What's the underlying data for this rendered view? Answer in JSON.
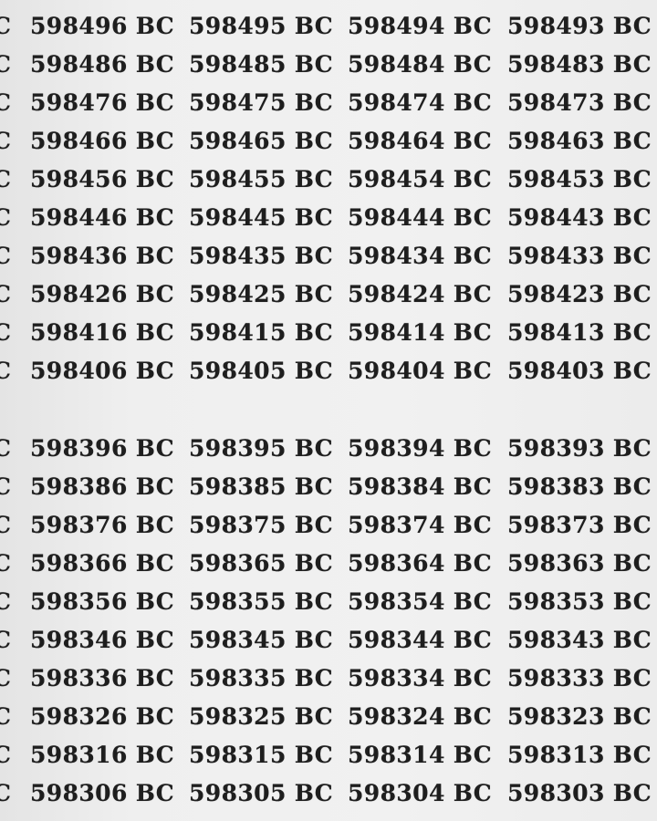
{
  "top_block": [
    {
      "partial": "C",
      "cells": [
        {
          "num": "598496",
          "suffix": "BC"
        },
        {
          "num": "598495",
          "suffix": "BC"
        },
        {
          "num": "598494",
          "suffix": "BC"
        },
        {
          "num": "598493",
          "suffix": "BC"
        }
      ]
    },
    {
      "partial": "C",
      "cells": [
        {
          "num": "598486",
          "suffix": "BC"
        },
        {
          "num": "598485",
          "suffix": "BC"
        },
        {
          "num": "598484",
          "suffix": "BC"
        },
        {
          "num": "598483",
          "suffix": "BC"
        }
      ]
    },
    {
      "partial": "C",
      "cells": [
        {
          "num": "598476",
          "suffix": "BC"
        },
        {
          "num": "598475",
          "suffix": "BC"
        },
        {
          "num": "598474",
          "suffix": "BC"
        },
        {
          "num": "598473",
          "suffix": "BC"
        }
      ]
    },
    {
      "partial": "C",
      "cells": [
        {
          "num": "598466",
          "suffix": "BC"
        },
        {
          "num": "598465",
          "suffix": "BC"
        },
        {
          "num": "598464",
          "suffix": "BC"
        },
        {
          "num": "598463",
          "suffix": "BC"
        }
      ]
    },
    {
      "partial": "C",
      "cells": [
        {
          "num": "598456",
          "suffix": "BC"
        },
        {
          "num": "598455",
          "suffix": "BC"
        },
        {
          "num": "598454",
          "suffix": "BC"
        },
        {
          "num": "598453",
          "suffix": "BC"
        }
      ]
    },
    {
      "partial": "C",
      "cells": [
        {
          "num": "598446",
          "suffix": "BC"
        },
        {
          "num": "598445",
          "suffix": "BC"
        },
        {
          "num": "598444",
          "suffix": "BC"
        },
        {
          "num": "598443",
          "suffix": "BC"
        }
      ]
    },
    {
      "partial": "C",
      "cells": [
        {
          "num": "598436",
          "suffix": "BC"
        },
        {
          "num": "598435",
          "suffix": "BC"
        },
        {
          "num": "598434",
          "suffix": "BC"
        },
        {
          "num": "598433",
          "suffix": "BC"
        }
      ]
    },
    {
      "partial": "C",
      "cells": [
        {
          "num": "598426",
          "suffix": "BC"
        },
        {
          "num": "598425",
          "suffix": "BC"
        },
        {
          "num": "598424",
          "suffix": "BC"
        },
        {
          "num": "598423",
          "suffix": "BC"
        }
      ]
    },
    {
      "partial": "C",
      "cells": [
        {
          "num": "598416",
          "suffix": "BC"
        },
        {
          "num": "598415",
          "suffix": "BC"
        },
        {
          "num": "598414",
          "suffix": "BC"
        },
        {
          "num": "598413",
          "suffix": "BC"
        }
      ]
    },
    {
      "partial": "C",
      "cells": [
        {
          "num": "598406",
          "suffix": "BC"
        },
        {
          "num": "598405",
          "suffix": "BC"
        },
        {
          "num": "598404",
          "suffix": "BC"
        },
        {
          "num": "598403",
          "suffix": "BC"
        }
      ]
    }
  ],
  "bottom_block": [
    {
      "partial": "C",
      "cells": [
        {
          "num": "598396",
          "suffix": "BC"
        },
        {
          "num": "598395",
          "suffix": "BC"
        },
        {
          "num": "598394",
          "suffix": "BC"
        },
        {
          "num": "598393",
          "suffix": "BC"
        }
      ]
    },
    {
      "partial": "C",
      "cells": [
        {
          "num": "598386",
          "suffix": "BC"
        },
        {
          "num": "598385",
          "suffix": "BC"
        },
        {
          "num": "598384",
          "suffix": "BC"
        },
        {
          "num": "598383",
          "suffix": "BC"
        }
      ]
    },
    {
      "partial": "C",
      "cells": [
        {
          "num": "598376",
          "suffix": "BC"
        },
        {
          "num": "598375",
          "suffix": "BC"
        },
        {
          "num": "598374",
          "suffix": "BC"
        },
        {
          "num": "598373",
          "suffix": "BC"
        }
      ]
    },
    {
      "partial": "C",
      "cells": [
        {
          "num": "598366",
          "suffix": "BC"
        },
        {
          "num": "598365",
          "suffix": "BC"
        },
        {
          "num": "598364",
          "suffix": "BC"
        },
        {
          "num": "598363",
          "suffix": "BC"
        }
      ]
    },
    {
      "partial": "C",
      "cells": [
        {
          "num": "598356",
          "suffix": "BC"
        },
        {
          "num": "598355",
          "suffix": "BC"
        },
        {
          "num": "598354",
          "suffix": "BC"
        },
        {
          "num": "598353",
          "suffix": "BC"
        }
      ]
    },
    {
      "partial": "C",
      "cells": [
        {
          "num": "598346",
          "suffix": "BC"
        },
        {
          "num": "598345",
          "suffix": "BC"
        },
        {
          "num": "598344",
          "suffix": "BC"
        },
        {
          "num": "598343",
          "suffix": "BC"
        }
      ]
    },
    {
      "partial": "C",
      "cells": [
        {
          "num": "598336",
          "suffix": "BC"
        },
        {
          "num": "598335",
          "suffix": "BC"
        },
        {
          "num": "598334",
          "suffix": "BC"
        },
        {
          "num": "598333",
          "suffix": "BC"
        }
      ]
    },
    {
      "partial": "C",
      "cells": [
        {
          "num": "598326",
          "suffix": "BC"
        },
        {
          "num": "598325",
          "suffix": "BC"
        },
        {
          "num": "598324",
          "suffix": "BC"
        },
        {
          "num": "598323",
          "suffix": "BC"
        }
      ]
    },
    {
      "partial": "C",
      "cells": [
        {
          "num": "598316",
          "suffix": "BC"
        },
        {
          "num": "598315",
          "suffix": "BC"
        },
        {
          "num": "598314",
          "suffix": "BC"
        },
        {
          "num": "598313",
          "suffix": "BC"
        }
      ]
    },
    {
      "partial": "C",
      "cells": [
        {
          "num": "598306",
          "suffix": "BC"
        },
        {
          "num": "598305",
          "suffix": "BC"
        },
        {
          "num": "598304",
          "suffix": "BC"
        },
        {
          "num": "598303",
          "suffix": "BC"
        }
      ]
    }
  ]
}
